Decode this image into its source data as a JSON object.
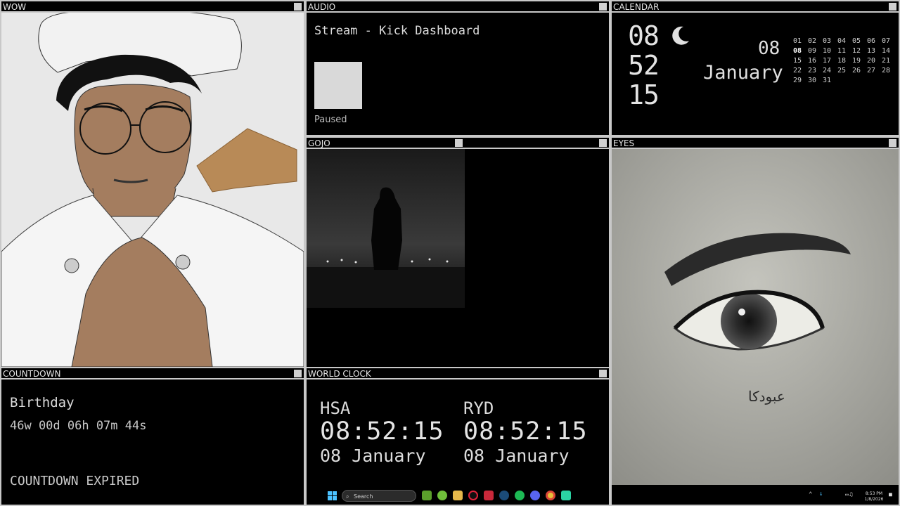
{
  "panels": {
    "wow": {
      "title": "WOW"
    },
    "audio": {
      "title": "AUDIO",
      "track": "Stream - Kick Dashboard",
      "status": "Paused"
    },
    "calendar": {
      "title": "CALENDAR",
      "hour": "08",
      "minute": "52",
      "second": "15",
      "day": "08",
      "month": "January",
      "days": [
        "01",
        "02",
        "03",
        "04",
        "05",
        "06",
        "07",
        "08",
        "09",
        "10",
        "11",
        "12",
        "13",
        "14",
        "15",
        "16",
        "17",
        "18",
        "19",
        "20",
        "21",
        "22",
        "23",
        "24",
        "25",
        "26",
        "27",
        "28",
        "29",
        "30",
        "31"
      ],
      "today": "08"
    },
    "gojo": {
      "title": "GOJO"
    },
    "eyes": {
      "title": "EYES",
      "signature": "عبودكا"
    },
    "countdown": {
      "title": "COUNTDOWN",
      "event": "Birthday",
      "remaining": "46w 00d 06h 07m 44s",
      "expired": "COUNTDOWN EXPIRED"
    },
    "worldclock": {
      "title": "WORLD CLOCK",
      "clocks": [
        {
          "city": "HSA",
          "time": "08:52:15",
          "date": "08 January"
        },
        {
          "city": "RYD",
          "time": "08:52:15",
          "date": "08 January"
        }
      ]
    }
  },
  "taskbar": {
    "search_label": "Search",
    "clock_time": "8:53 PM",
    "clock_date": "1/8/2026"
  },
  "colors": {
    "border": "#c8c8c8",
    "background": "#000000"
  }
}
